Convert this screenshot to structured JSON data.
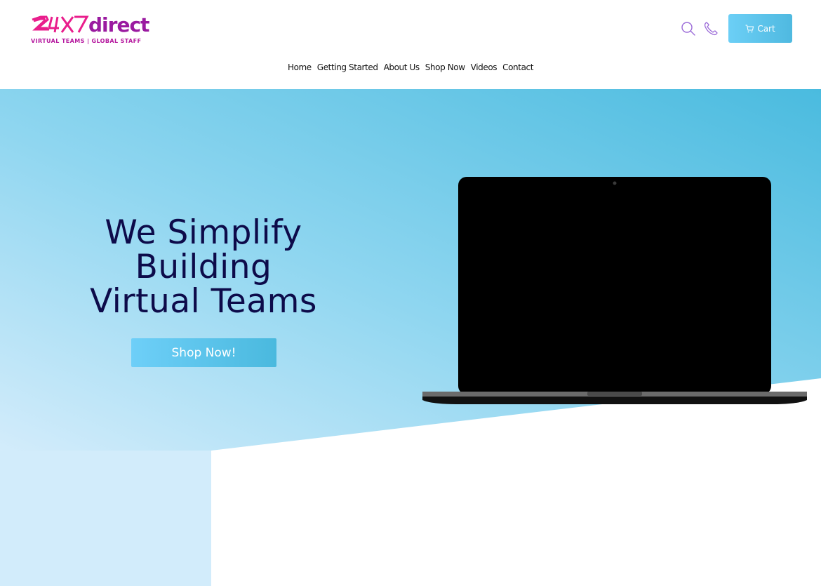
{
  "brand": {
    "logo_text": "24X7direct",
    "tagline": "VIRTUAL TEAMS | GLOBAL STAFF",
    "color_primary": "#e91e8c",
    "color_secondary": "#9a1aa0"
  },
  "header": {
    "search_icon": "search-icon",
    "phone_icon": "phone-icon",
    "cart_label": "Cart",
    "cart_icon": "cart-icon",
    "accent": "#55c0e8"
  },
  "nav": {
    "items": [
      {
        "label": "Home"
      },
      {
        "label": "Getting Started"
      },
      {
        "label": "About Us"
      },
      {
        "label": "Shop Now"
      },
      {
        "label": "Videos"
      },
      {
        "label": "Contact"
      }
    ]
  },
  "hero": {
    "title_lines": [
      "We Simplify",
      "Building",
      "Virtual Teams"
    ],
    "cta_label": "Shop Now!",
    "title_color": "#0d0b4a"
  }
}
